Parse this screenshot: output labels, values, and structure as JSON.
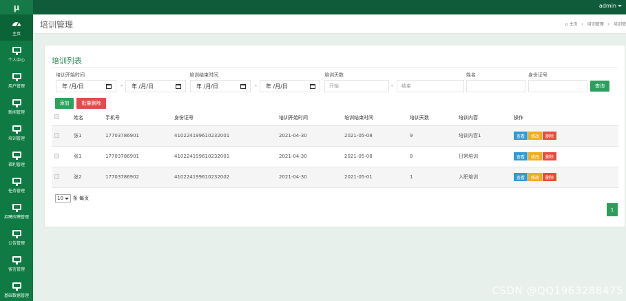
{
  "app": {
    "logo": "μ",
    "user": "admin"
  },
  "sidebar": {
    "items": [
      {
        "label": "主页",
        "icon": "dashboard-icon"
      },
      {
        "label": "个人中心",
        "icon": "monitor-icon"
      },
      {
        "label": "用户管理",
        "icon": "monitor-icon"
      },
      {
        "label": "新闻管理",
        "icon": "monitor-icon"
      },
      {
        "label": "培训管理",
        "icon": "monitor-icon"
      },
      {
        "label": "福利管理",
        "icon": "monitor-icon"
      },
      {
        "label": "任务管理",
        "icon": "monitor-icon"
      },
      {
        "label": "招聘应聘管理",
        "icon": "monitor-icon"
      },
      {
        "label": "公告管理",
        "icon": "monitor-icon"
      },
      {
        "label": "留言管理",
        "icon": "monitor-icon"
      },
      {
        "label": "基础数据管理",
        "icon": "monitor-icon"
      }
    ]
  },
  "header": {
    "title": "培训管理",
    "breadcrumb": [
      "主页",
      "培训管理",
      "培训管"
    ]
  },
  "card": {
    "title": "培训列表"
  },
  "filters": {
    "start_label": "培训开始时间",
    "end_label": "培训结束时间",
    "days_label": "培训天数",
    "name_label": "姓名",
    "id_label": "身份证号",
    "date_placeholder": "年 /月/日",
    "days_from_placeholder": "开始",
    "days_to_placeholder": "结束",
    "query_button": "查询"
  },
  "actions": {
    "add": "添加",
    "batch_delete": "批量删除"
  },
  "table": {
    "headers": [
      "姓名",
      "手机号",
      "身份证号",
      "培训开始时间",
      "培训结束时间",
      "培训天数",
      "培训内容",
      "操作"
    ],
    "rows": [
      {
        "name": "张1",
        "phone": "17703786901",
        "id": "410224199610232001",
        "start": "2021-04-30",
        "end": "2021-05-08",
        "days": "9",
        "content": "培训内容1"
      },
      {
        "name": "张1",
        "phone": "17703786901",
        "id": "410224199610232001",
        "start": "2021-04-30",
        "end": "2021-05-08",
        "days": "8",
        "content": "日常培训"
      },
      {
        "name": "张2",
        "phone": "17703786902",
        "id": "410224199610232002",
        "start": "2021-04-30",
        "end": "2021-05-01",
        "days": "1",
        "content": "入职培训"
      }
    ],
    "op_view": "查看",
    "op_edit": "修改",
    "op_delete": "删除"
  },
  "pagination": {
    "page_size": "10",
    "per_page_suffix": "条 每页",
    "current_page": "1"
  },
  "watermark": "CSDN @QQ1963288475"
}
